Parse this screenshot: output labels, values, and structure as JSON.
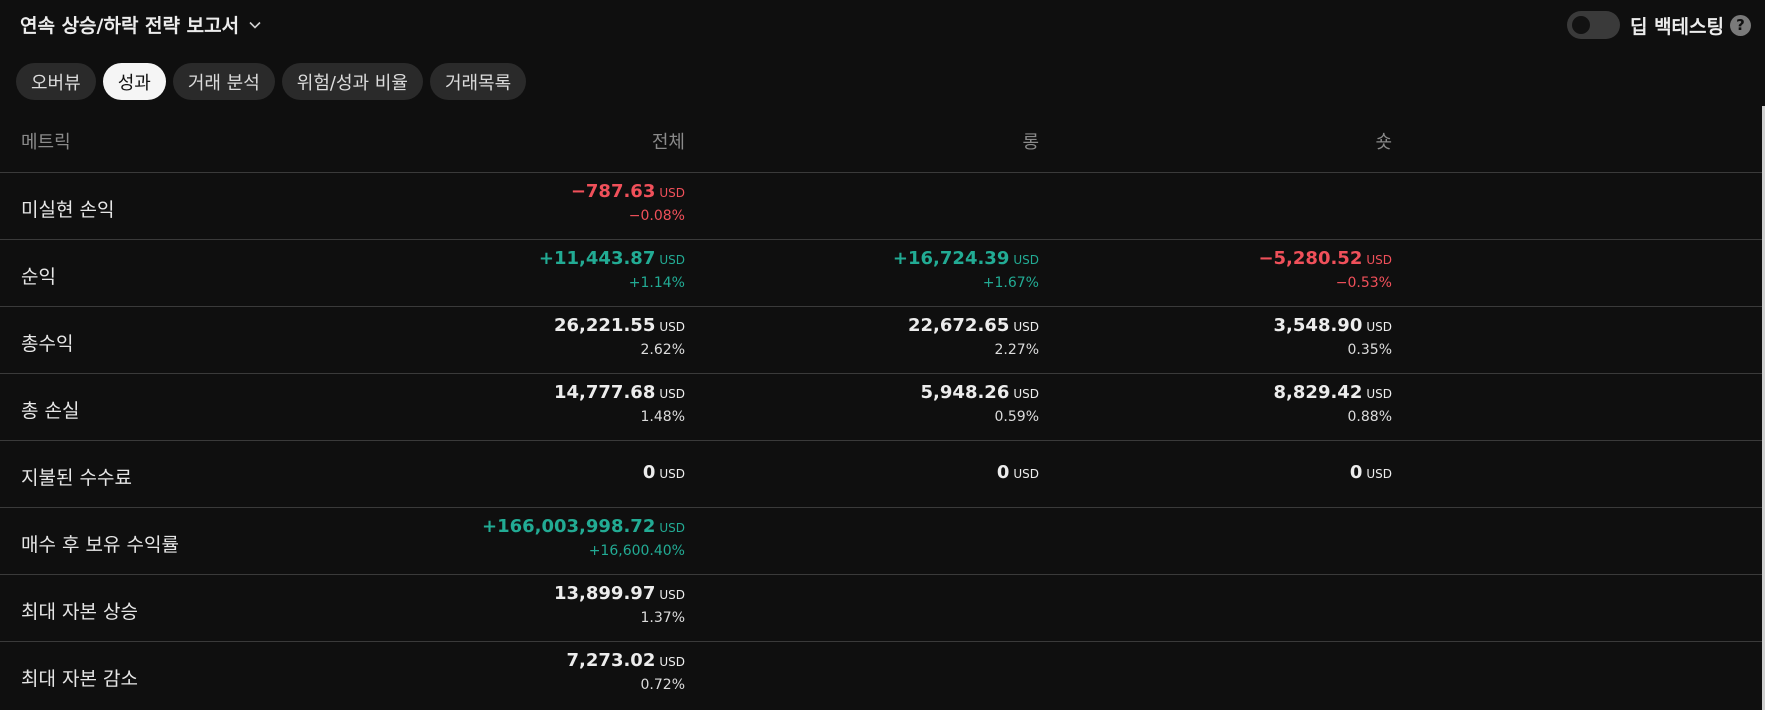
{
  "header": {
    "title": "연속 상승/하락 전략 보고서",
    "deep_backtest_label": "딥 백테스팅",
    "deep_backtest_enabled": false,
    "help_symbol": "?"
  },
  "tabs": [
    {
      "label": "오버뷰",
      "active": false
    },
    {
      "label": "성과",
      "active": true
    },
    {
      "label": "거래 분석",
      "active": false
    },
    {
      "label": "위험/성과 비율",
      "active": false
    },
    {
      "label": "거래목록",
      "active": false
    }
  ],
  "table": {
    "columns": {
      "metric": "메트릭",
      "all": "전체",
      "long": "롱",
      "short": "숏"
    },
    "unit": "USD",
    "rows": [
      {
        "label": "미실현 손익",
        "all": {
          "value": "−787.63",
          "pct": "−0.08%",
          "tone": "neg"
        }
      },
      {
        "label": "순익",
        "all": {
          "value": "+11,443.87",
          "pct": "+1.14%",
          "tone": "pos"
        },
        "long": {
          "value": "+16,724.39",
          "pct": "+1.67%",
          "tone": "pos"
        },
        "short": {
          "value": "−5,280.52",
          "pct": "−0.53%",
          "tone": "neg"
        }
      },
      {
        "label": "총수익",
        "all": {
          "value": "26,221.55",
          "pct": "2.62%"
        },
        "long": {
          "value": "22,672.65",
          "pct": "2.27%"
        },
        "short": {
          "value": "3,548.90",
          "pct": "0.35%"
        }
      },
      {
        "label": "총 손실",
        "all": {
          "value": "14,777.68",
          "pct": "1.48%"
        },
        "long": {
          "value": "5,948.26",
          "pct": "0.59%"
        },
        "short": {
          "value": "8,829.42",
          "pct": "0.88%"
        }
      },
      {
        "label": "지불된 수수료",
        "all": {
          "value": "0"
        },
        "long": {
          "value": "0"
        },
        "short": {
          "value": "0"
        }
      },
      {
        "label": "매수 후 보유 수익률",
        "all": {
          "value": "+166,003,998.72",
          "pct": "+16,600.40%",
          "tone": "pos"
        }
      },
      {
        "label": "최대 자본 상승",
        "all": {
          "value": "13,899.97",
          "pct": "1.37%"
        }
      },
      {
        "label": "최대 자본 감소",
        "all": {
          "value": "7,273.02",
          "pct": "0.72%"
        }
      }
    ]
  },
  "colors": {
    "positive": "#22ab94",
    "negative": "#f0505a",
    "background": "#0f0f0f"
  }
}
